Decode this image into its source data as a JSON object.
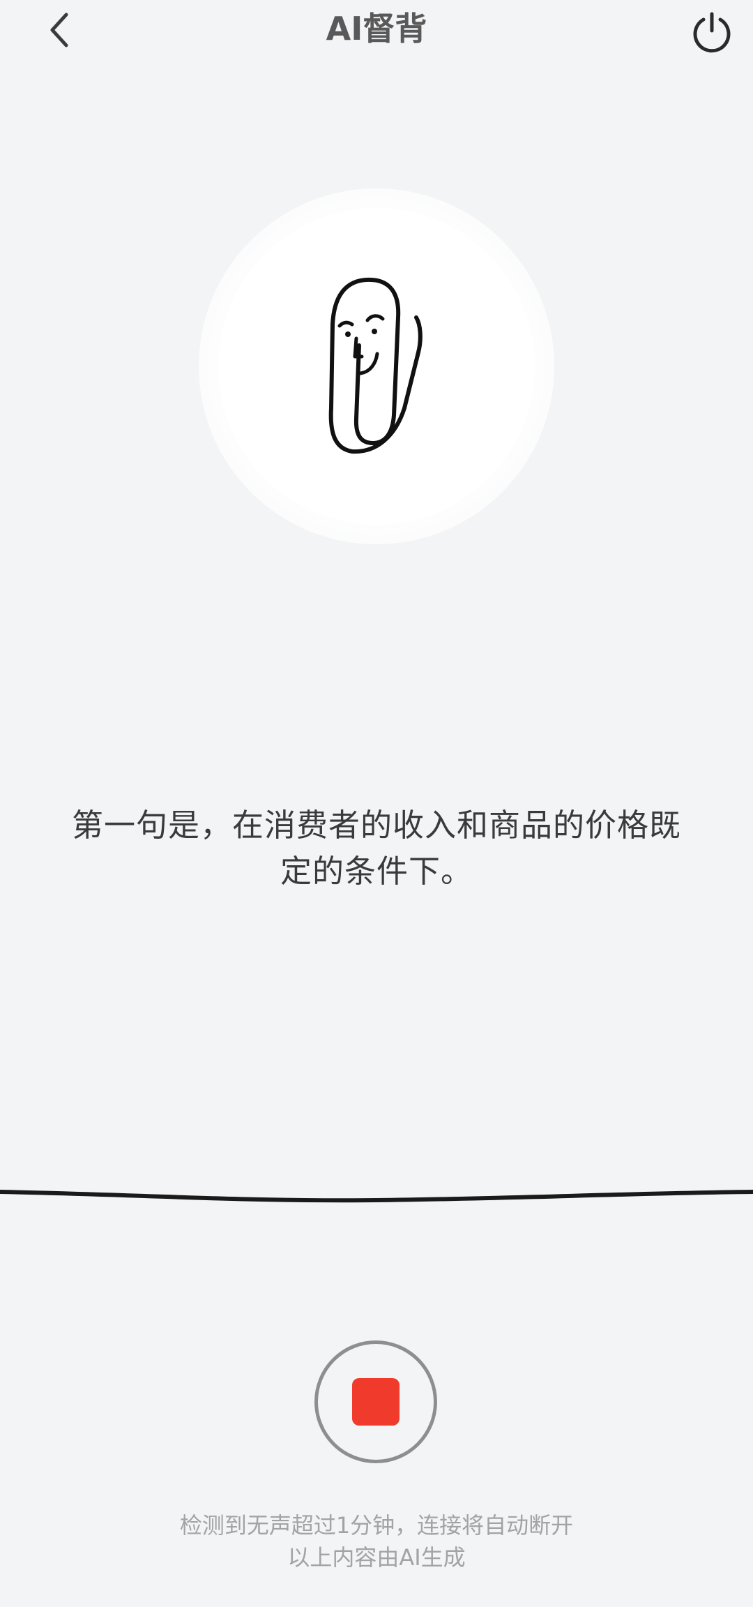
{
  "header": {
    "title": "AI督背",
    "back_icon": "chevron-left-icon",
    "power_icon": "power-icon"
  },
  "assistant": {
    "avatar_icon": "paperclip-face-icon"
  },
  "main": {
    "sentence": "第一句是，在消费者的收入和商品的价格既定的条件下。"
  },
  "controls": {
    "stop_icon": "stop-icon",
    "stop_color": "#f03a2c"
  },
  "footer": {
    "notice_line1": "检测到无声超过1分钟，连接将自动断开",
    "notice_line2": "以上内容由AI生成"
  },
  "colors": {
    "background": "#f3f4f6",
    "title_text": "#595959",
    "body_text": "#3a3a3a",
    "muted_text": "#a3a3a3"
  }
}
